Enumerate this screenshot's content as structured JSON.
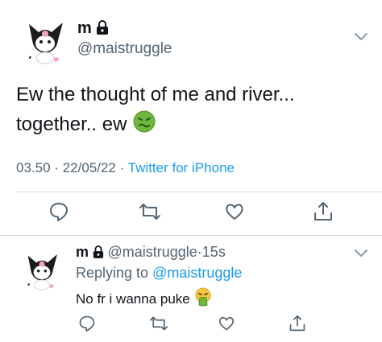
{
  "main_tweet": {
    "display_name": "m",
    "handle": "@maistruggle",
    "text_line1": "Ew the thought of me and river...",
    "text_line2": "together.. ew",
    "emoji": "nauseated-face",
    "time": "03.50",
    "separator1": "·",
    "date": "22/05/22",
    "separator2": "·",
    "source": "Twitter for iPhone"
  },
  "reply_tweet": {
    "display_name": "m",
    "handle": "@maistruggle",
    "separator": "·",
    "age": "15s",
    "replying_prefix": "Replying to",
    "replying_handle": "@maistruggle",
    "text": "No fr i wanna puke",
    "emoji": "vomiting-face"
  },
  "colors": {
    "accent": "#1d9bf0",
    "secondary_text": "#536471",
    "primary_text": "#0f1419",
    "divider": "#cfd9de",
    "emoji_green": "#6fb83f"
  }
}
